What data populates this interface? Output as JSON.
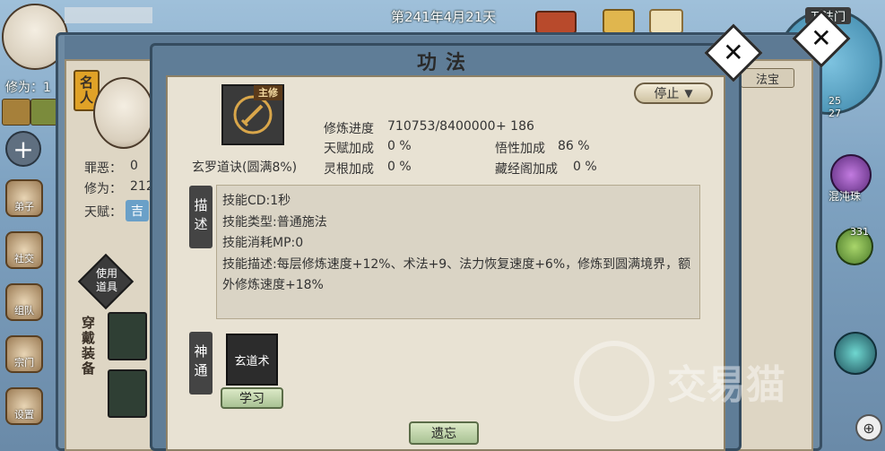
{
  "hud": {
    "date": "第241年4月21天",
    "sect_name": "万法门",
    "cultivation_label": "修为：1",
    "map_num_1": "25",
    "map_num_2": "27",
    "orb_count": "331",
    "orb_name": "混沌珠"
  },
  "left_nav": [
    {
      "label": "弟子",
      "icon": "disciple-icon"
    },
    {
      "label": "社交",
      "icon": "social-icon"
    },
    {
      "label": "组队",
      "icon": "team-icon"
    },
    {
      "label": "宗门",
      "icon": "sect-icon"
    },
    {
      "label": "设置",
      "icon": "settings-icon"
    }
  ],
  "character": {
    "tag": "名人",
    "sin_label": "罪恶：",
    "sin_value": "0",
    "cult_label": "修为：",
    "cult_value": "212",
    "talent_label": "天赋：",
    "talent_value": "吉",
    "use_item": "使用道具",
    "equip_label": "穿戴装备",
    "fabao_tab": "法宝"
  },
  "dialog": {
    "title": "功法",
    "skill_tag": "主修",
    "skill_name": "玄罗道诀(圆满8%)",
    "progress_label": "修炼进度",
    "progress_value": "710753/8400000",
    "progress_bonus": "+ 186",
    "talent_bonus_label": "天赋加成",
    "talent_bonus_value": "0 %",
    "comprehension_label": "悟性加成",
    "comprehension_value": "86 %",
    "root_bonus_label": "灵根加成",
    "root_bonus_value": "0 %",
    "library_bonus_label": "藏经阁加成",
    "library_bonus_value": "0 %",
    "stop_button": "停止",
    "desc_label": "描述",
    "desc_lines": [
      "技能CD:1秒",
      "技能类型:普通施法",
      "技能消耗MP:0",
      "技能描述:每层修炼速度+12%、术法+9、法力恢复速度+6%，修炼到圆满境界，额外修炼速度+18%"
    ],
    "shentong_label": "神通",
    "shentong_skill": "玄道术",
    "learn_button": "学习",
    "forget_button": "遗忘"
  },
  "watermark": "交易猫"
}
